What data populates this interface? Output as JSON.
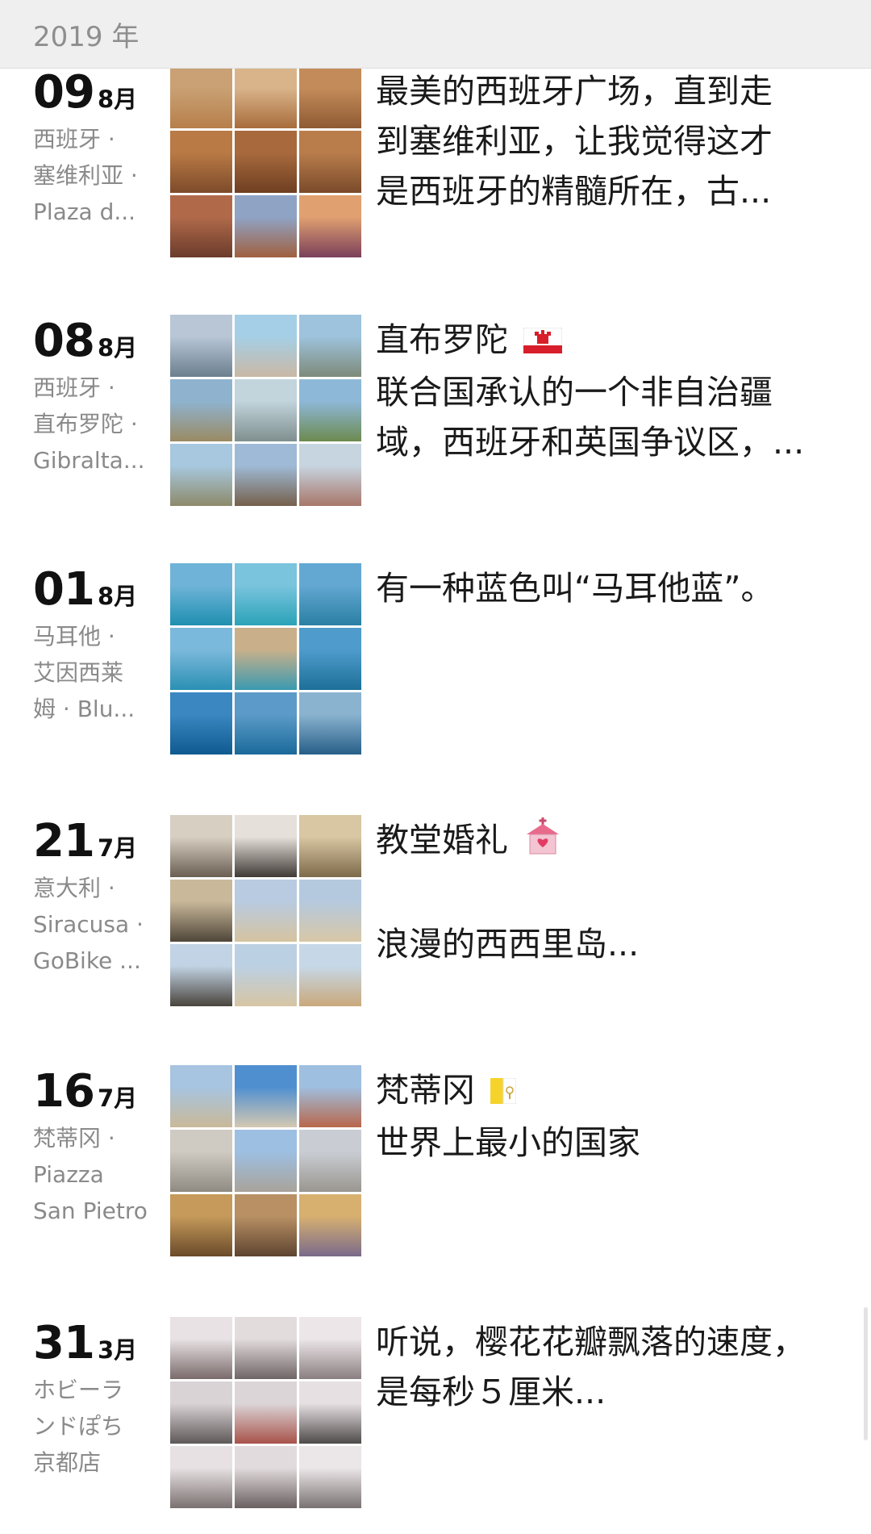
{
  "header": {
    "year": "2019 年"
  },
  "entries": [
    {
      "day": "09",
      "month": "8月",
      "location_lines": [
        "西班牙 ·",
        "塞维利亚 ·",
        " Plaza d..."
      ],
      "caption_lines": [
        "最美的西班牙广场，直到走",
        "到塞维利亚，让我觉得这才",
        "是西班牙的精髓所在，古..."
      ],
      "photos": [
        [
          "#c9a174",
          "#b77f4b"
        ],
        [
          "#d9b48a",
          "#a86d3c"
        ],
        [
          "#c48b5a",
          "#8f5a33"
        ],
        [
          "#b97a45",
          "#7d4b2a"
        ],
        [
          "#a86a3d",
          "#6e3f22"
        ],
        [
          "#b97d4c",
          "#7a4a2a"
        ],
        [
          "#b06a4a",
          "#6b3b2b"
        ],
        [
          "#8fa3c5",
          "#a0603f"
        ],
        [
          "#e0a070",
          "#7a3f5a"
        ]
      ]
    },
    {
      "day": "08",
      "month": "8月",
      "location_lines": [
        "西班牙 ·",
        "直布罗陀 ·",
        " Gibralta..."
      ],
      "caption_lines": [
        "直布罗陀",
        "联合国承认的一个非自治疆",
        "域，西班牙和英国争议区，..."
      ],
      "flag": "gibraltar-flag-icon",
      "photos": [
        [
          "#b8c6d6",
          "#6b7f8f"
        ],
        [
          "#a5cfe6",
          "#c9b8a5"
        ],
        [
          "#9ec3dd",
          "#7d8a7a"
        ],
        [
          "#8fb3cf",
          "#9a8a63"
        ],
        [
          "#c2d4dc",
          "#7f8f8f"
        ],
        [
          "#8eb8d8",
          "#6c8a4f"
        ],
        [
          "#a7c8de",
          "#8d8a6b"
        ],
        [
          "#9fbad6",
          "#75604b"
        ],
        [
          "#c7d5e0",
          "#a8766a"
        ]
      ]
    },
    {
      "day": "01",
      "month": "8月",
      "location_lines": [
        "马耳他 ·",
        "艾因西莱",
        "姆 · Blu..."
      ],
      "caption_lines": [
        "有一种蓝色叫“马耳他蓝”。"
      ],
      "photos": [
        [
          "#6fb4d8",
          "#1f8fb0"
        ],
        [
          "#7ac4dd",
          "#2aa3b8"
        ],
        [
          "#63a8d2",
          "#2a7fa3"
        ],
        [
          "#7bb9dc",
          "#2a90b3"
        ],
        [
          "#c9b08a",
          "#3a9ab0"
        ],
        [
          "#4f9ccc",
          "#1d6f98"
        ],
        [
          "#3a87c2",
          "#0f5a8f"
        ],
        [
          "#5c9bc9",
          "#1a6a9a"
        ],
        [
          "#8ab3cf",
          "#275f88"
        ]
      ]
    },
    {
      "day": "21",
      "month": "7月",
      "location_lines": [
        "意大利 ·",
        "Siracusa ·",
        " GoBike ..."
      ],
      "caption_lines": [
        "教堂婚礼",
        "",
        "浪漫的西西里岛..."
      ],
      "flag": "wedding-chapel-icon",
      "photos": [
        [
          "#d8cfc3",
          "#6a5e52"
        ],
        [
          "#e5e0d9",
          "#3f3a36"
        ],
        [
          "#d9c6a3",
          "#7d6a4a"
        ],
        [
          "#c9b89a",
          "#4f4639"
        ],
        [
          "#b8cbe0",
          "#d6c3a0"
        ],
        [
          "#b5c9de",
          "#d8c7a6"
        ],
        [
          "#c1d3e4",
          "#4a443c"
        ],
        [
          "#bcd0e3",
          "#d6c5a3"
        ],
        [
          "#c6d8e8",
          "#caa97a"
        ]
      ]
    },
    {
      "day": "16",
      "month": "7月",
      "location_lines": [
        "梵蒂冈 ·",
        "Piazza",
        "San Pietro"
      ],
      "caption_lines": [
        "梵蒂冈",
        "世界上最小的国家"
      ],
      "flag": "vatican-flag-icon",
      "photos": [
        [
          "#a7c4e0",
          "#c9b999"
        ],
        [
          "#4f8fd0",
          "#d4c8b2"
        ],
        [
          "#9fbfe0",
          "#b8674a"
        ],
        [
          "#cfcac2",
          "#8f8a82"
        ],
        [
          "#9dbfe2",
          "#a9a39a"
        ],
        [
          "#c9cdd3",
          "#9a9690"
        ],
        [
          "#c59a5a",
          "#6a4a2a"
        ],
        [
          "#b89064",
          "#5e4430"
        ],
        [
          "#d7b070",
          "#7a6a8a"
        ]
      ]
    },
    {
      "day": "31",
      "month": "3月",
      "location_lines": [
        "ホビーラ",
        "ンドぽち",
        "京都店"
      ],
      "caption_lines": [
        "听说，樱花花瓣飘落的速度，",
        "是每秒５厘米..."
      ],
      "photos": [
        [
          "#e8e2e4",
          "#7a6b6b"
        ],
        [
          "#e3dcdd",
          "#6f6565"
        ],
        [
          "#ece6e8",
          "#8a7f80"
        ],
        [
          "#d9d3d6",
          "#5f5858"
        ],
        [
          "#dcd5d8",
          "#a7524a"
        ],
        [
          "#e6e0e2",
          "#4f4a4a"
        ],
        [
          "#e7e1e3",
          "#7a7070"
        ],
        [
          "#e2dbdd",
          "#6a6060"
        ],
        [
          "#ebe6e8",
          "#7a7272"
        ]
      ]
    }
  ],
  "colors": {
    "header_bg": "#efefef",
    "year_text": "#8e8e8e",
    "location_text": "#8a8a8a",
    "primary_text": "#1a1a1a"
  }
}
